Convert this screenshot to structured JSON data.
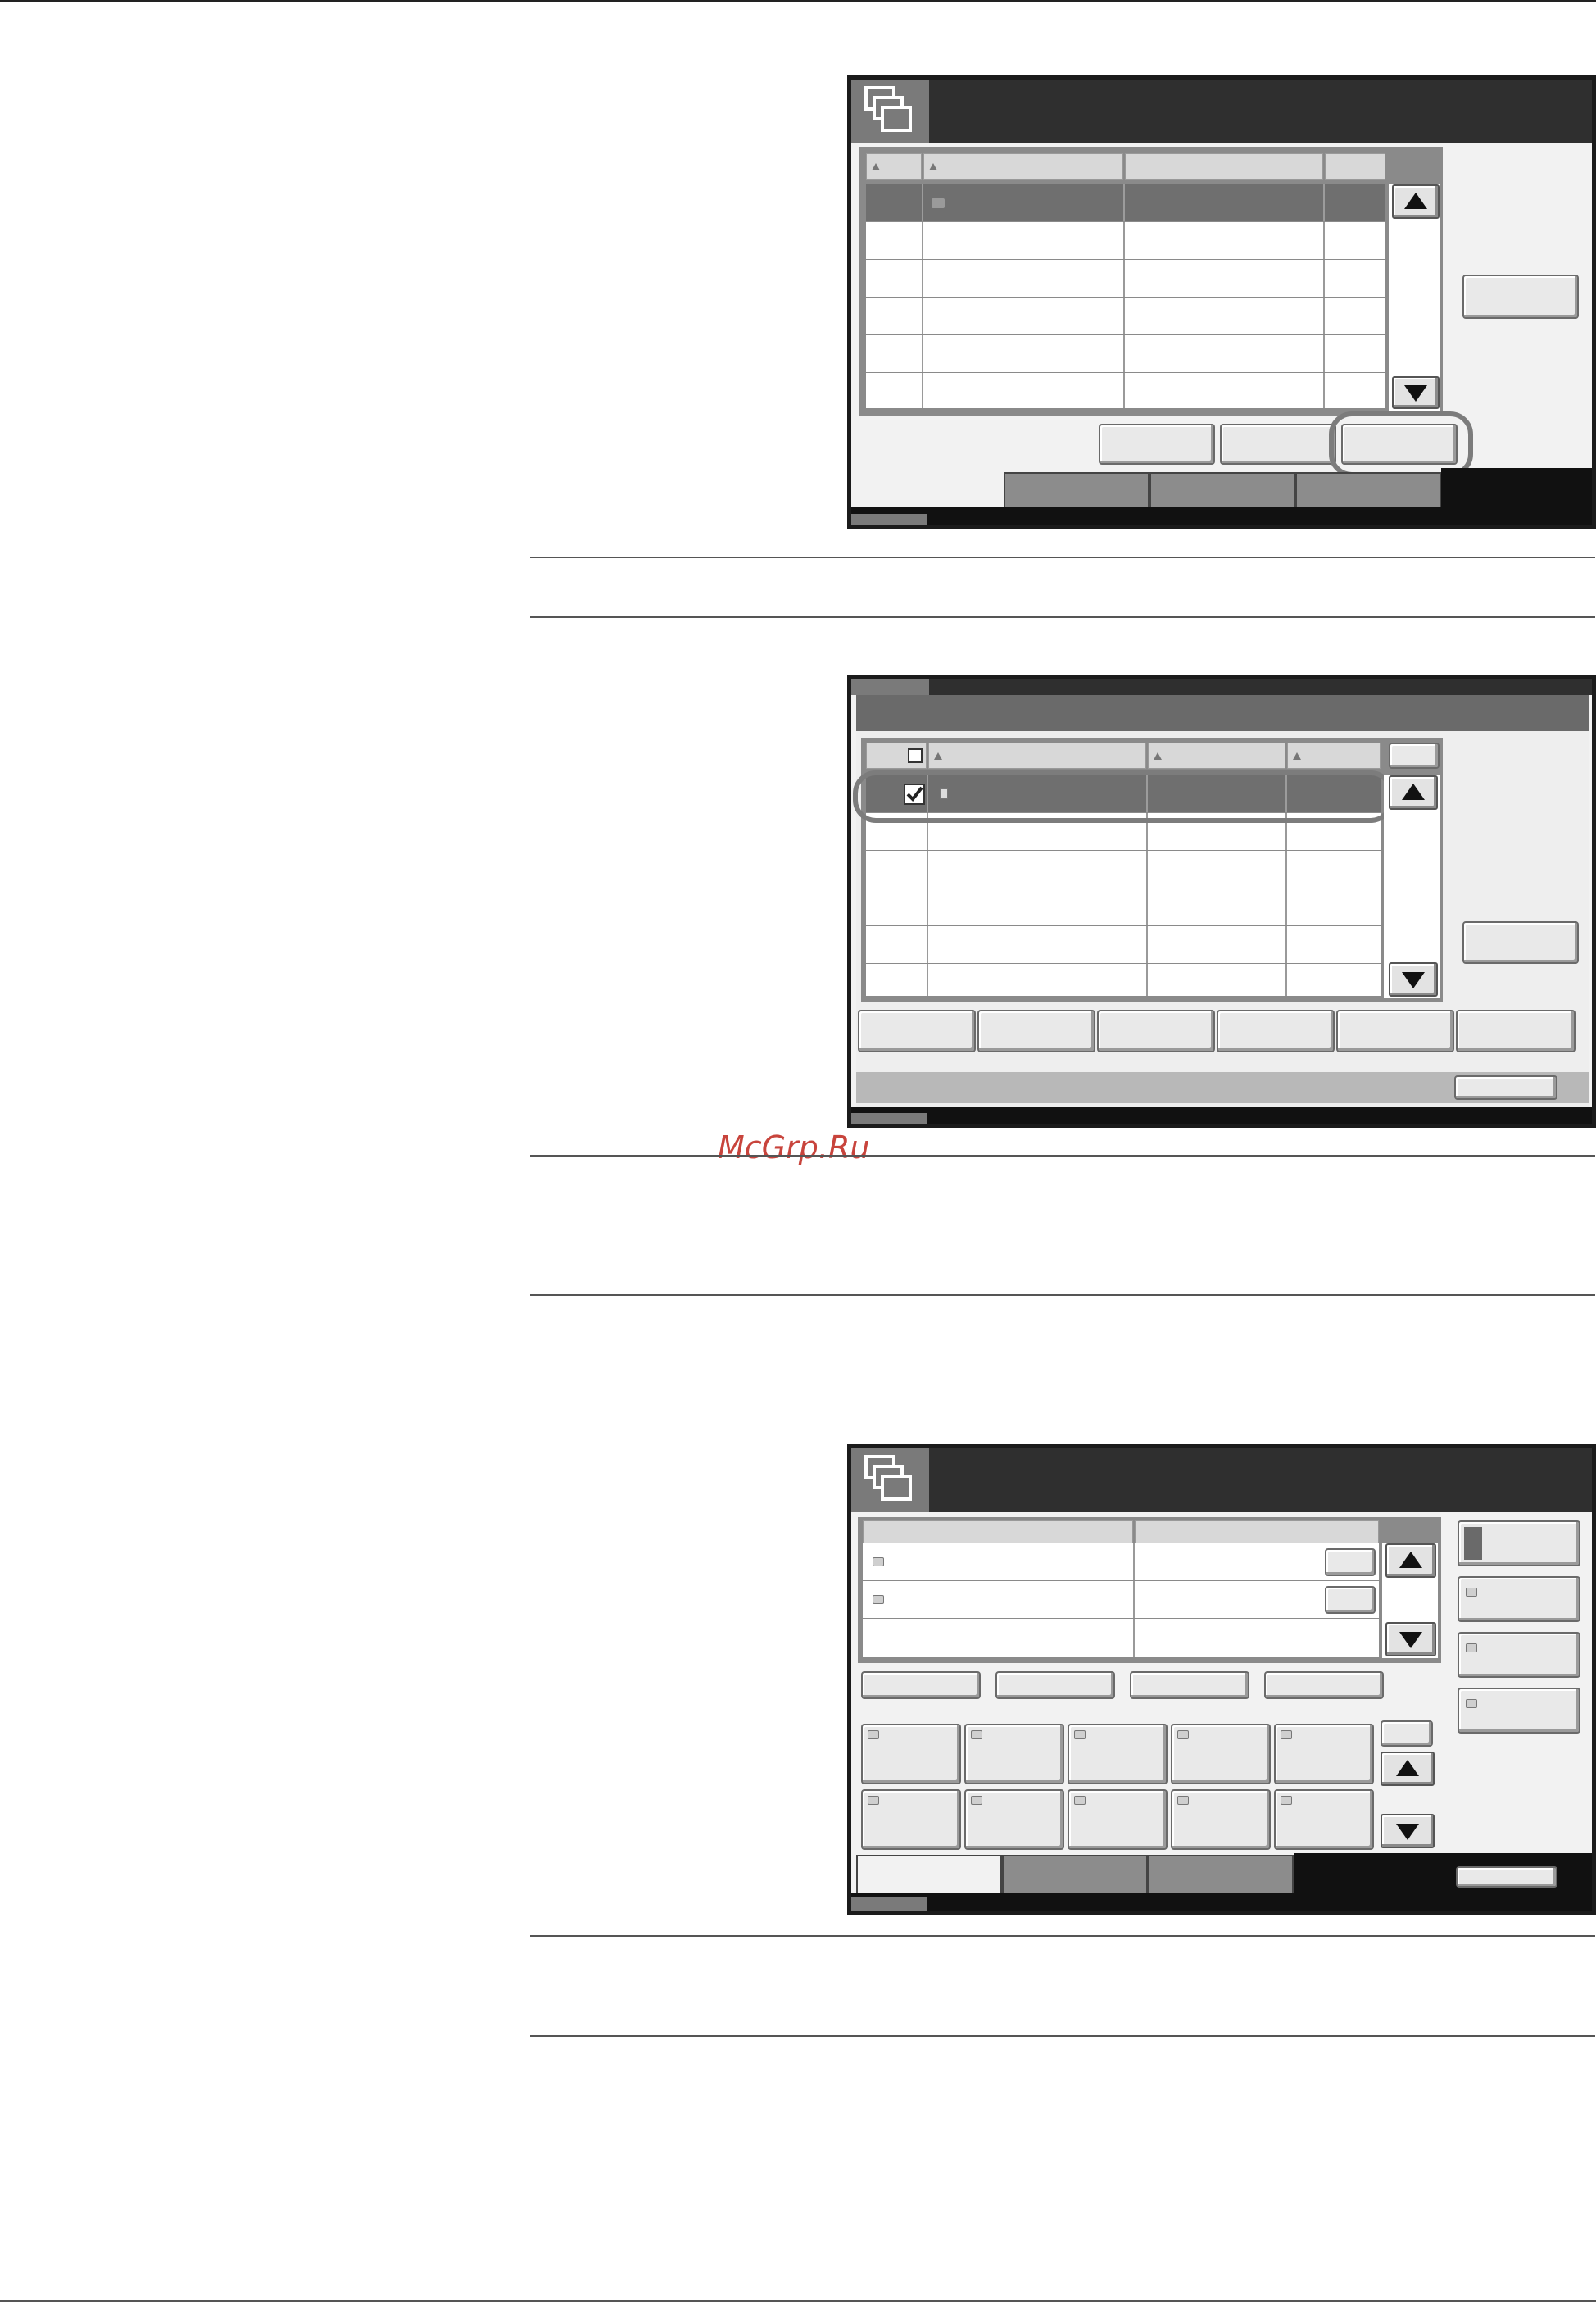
{
  "watermark": {
    "text": "McGrp.Ru",
    "color": "#c8443c"
  },
  "icons": {
    "box_icon": "stacked-folders-icon",
    "scroll_up": "triangle-up-icon",
    "scroll_down": "triangle-down-icon",
    "folder": "folder-icon",
    "document": "document-icon",
    "checkbox": "checkbox-checked-icon",
    "email_address": "envelope-icon",
    "folder_address": "folder-address-icon"
  },
  "colors": {
    "header": "#2f2f2f",
    "selection": "#6f6f6f",
    "callout": "#7c7c7c",
    "footer": "#111111"
  }
}
